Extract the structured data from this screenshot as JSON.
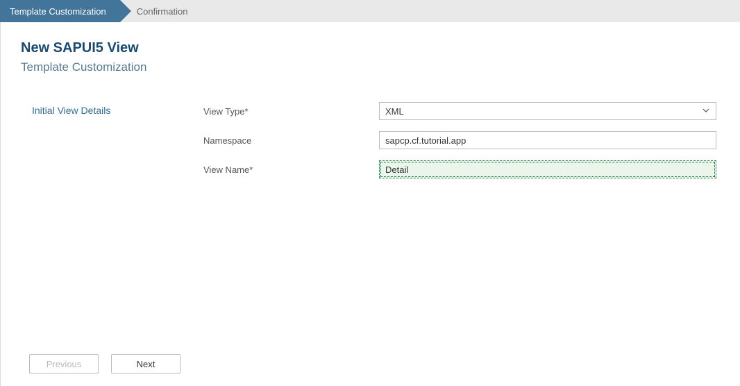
{
  "breadcrumb": {
    "steps": [
      {
        "label": "Template Customization",
        "active": true
      },
      {
        "label": "Confirmation",
        "active": false
      }
    ]
  },
  "header": {
    "title": "New SAPUI5 View",
    "subtitle": "Template Customization"
  },
  "form": {
    "section_label": "Initial View Details",
    "view_type": {
      "label": "View Type*",
      "value": "XML"
    },
    "namespace": {
      "label": "Namespace",
      "value": "sapcp.cf.tutorial.app"
    },
    "view_name": {
      "label": "View Name*",
      "value": "Detail"
    }
  },
  "footer": {
    "previous_label": "Previous",
    "next_label": "Next"
  }
}
